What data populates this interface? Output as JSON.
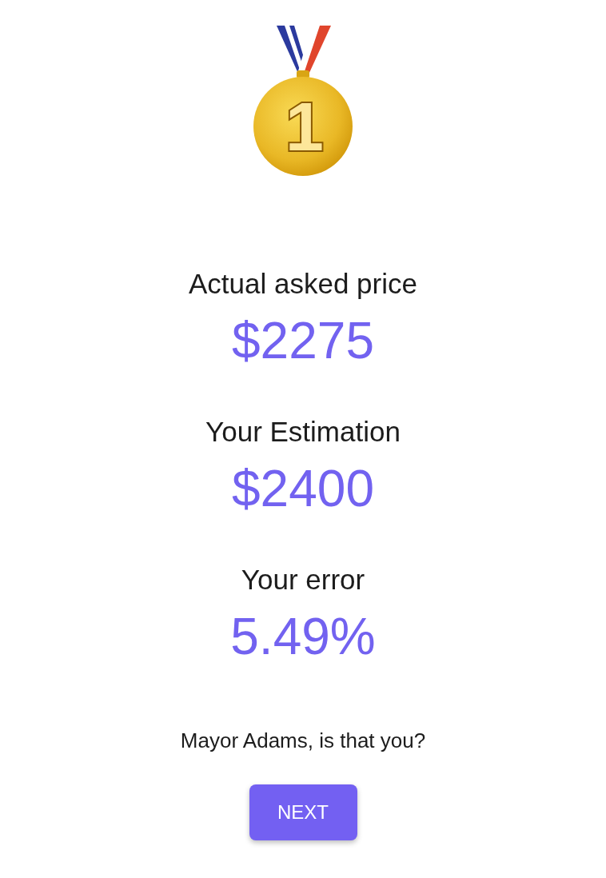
{
  "medal": {
    "number": "1"
  },
  "results": [
    {
      "label": "Actual asked price",
      "value": "$2275"
    },
    {
      "label": "Your Estimation",
      "value": "$2400"
    },
    {
      "label": "Your error",
      "value": "5.49%"
    }
  ],
  "message": "Mayor Adams, is that you?",
  "button": {
    "label": "NEXT"
  }
}
